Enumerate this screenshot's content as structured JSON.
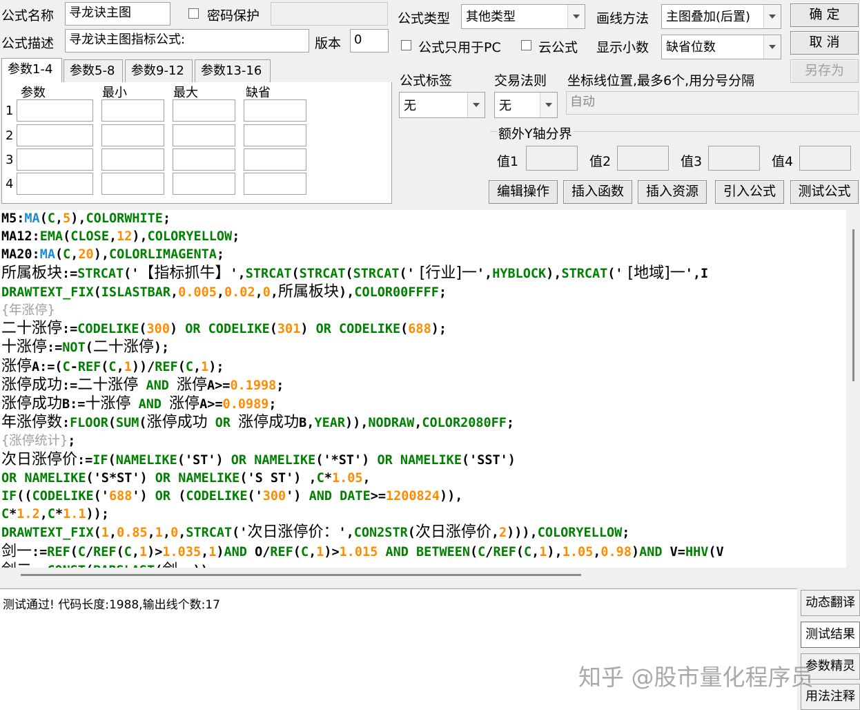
{
  "header": {
    "name_label": "公式名称",
    "name_value": "寻龙诀主图",
    "password_label": "密码保护",
    "password_value": "",
    "desc_label": "公式描述",
    "desc_value": "寻龙诀主图指标公式:",
    "version_label": "版本",
    "version_value": "0",
    "type_label": "公式类型",
    "type_value": "其他类型",
    "draw_label": "画线方法",
    "draw_value": "主图叠加(后置)",
    "pc_only_label": "公式只用于PC",
    "cloud_label": "云公式",
    "decimals_label": "显示小数",
    "decimals_value": "缺省位数"
  },
  "buttons": {
    "ok": "确  定",
    "cancel": "取  消",
    "save_as": "另存为",
    "edit_ops": "编辑操作",
    "insert_func": "插入函数",
    "insert_res": "插入资源",
    "import_formula": "引入公式",
    "test_formula": "测试公式"
  },
  "tabs": [
    "参数1-4",
    "参数5-8",
    "参数9-12",
    "参数13-16"
  ],
  "params": {
    "headers": [
      "参数",
      "最小",
      "最大",
      "缺省"
    ],
    "rows": [
      "1",
      "2",
      "3",
      "4"
    ]
  },
  "options": {
    "tag_label": "公式标签",
    "tag_value": "无",
    "trade_label": "交易法则",
    "trade_value": "无",
    "axis_label": "坐标线位置,最多6个,用分号分隔",
    "axis_value": "自动",
    "y_group_label": "额外Y轴分界",
    "y_vals": [
      "值1",
      "值2",
      "值3",
      "值4"
    ]
  },
  "code_lines": [
    [
      [
        "t",
        "M5:"
      ],
      [
        "f",
        "MA"
      ],
      [
        "t",
        "("
      ],
      [
        "k",
        "C"
      ],
      [
        "t",
        ","
      ],
      [
        "n",
        "5"
      ],
      [
        "t",
        "),"
      ],
      [
        "k",
        "COLORWHITE"
      ],
      [
        "t",
        ";"
      ]
    ],
    [
      [
        "t",
        "MA12:"
      ],
      [
        "k",
        "EMA"
      ],
      [
        "t",
        "("
      ],
      [
        "k",
        "CLOSE"
      ],
      [
        "t",
        ","
      ],
      [
        "n",
        "12"
      ],
      [
        "t",
        "),"
      ],
      [
        "k",
        "COLORYELLOW"
      ],
      [
        "t",
        ";"
      ]
    ],
    [
      [
        "t",
        "MA20:"
      ],
      [
        "f",
        "MA"
      ],
      [
        "t",
        "("
      ],
      [
        "k",
        "C"
      ],
      [
        "t",
        ","
      ],
      [
        "n",
        "20"
      ],
      [
        "t",
        "),"
      ],
      [
        "k",
        "COLORLIMAGENTA"
      ],
      [
        "t",
        ";"
      ]
    ],
    [
      [
        "cn",
        "所属板块"
      ],
      [
        "t",
        ":="
      ],
      [
        "k",
        "STRCAT"
      ],
      [
        "t",
        "('"
      ],
      [
        "cn",
        "【指标抓牛】"
      ],
      [
        "t",
        "',"
      ],
      [
        "k",
        "STRCAT"
      ],
      [
        "t",
        "("
      ],
      [
        "k",
        "STRCAT"
      ],
      [
        "t",
        "("
      ],
      [
        "k",
        "STRCAT"
      ],
      [
        "t",
        "('"
      ],
      [
        "cn",
        " [行业]一"
      ],
      [
        "t",
        "',"
      ],
      [
        "k",
        "HYBLOCK"
      ],
      [
        "t",
        "),"
      ],
      [
        "k",
        "STRCAT"
      ],
      [
        "t",
        "('"
      ],
      [
        "cn",
        " [地域]一"
      ],
      [
        "t",
        "',I"
      ]
    ],
    [
      [
        "k",
        "DRAWTEXT_FIX"
      ],
      [
        "t",
        "("
      ],
      [
        "k",
        "ISLASTBAR"
      ],
      [
        "t",
        ","
      ],
      [
        "n",
        "0.005"
      ],
      [
        "t",
        ","
      ],
      [
        "n",
        "0.02"
      ],
      [
        "t",
        ","
      ],
      [
        "n",
        "0"
      ],
      [
        "t",
        ","
      ],
      [
        "cn",
        "所属板块"
      ],
      [
        "t",
        "),"
      ],
      [
        "k",
        "COLOR00FFFF"
      ],
      [
        "t",
        ";"
      ]
    ],
    [
      [
        "cm",
        "{年涨停}"
      ]
    ],
    [
      [
        "cn",
        "二十涨停"
      ],
      [
        "t",
        ":="
      ],
      [
        "k",
        "CODELIKE"
      ],
      [
        "t",
        "("
      ],
      [
        "n",
        "300"
      ],
      [
        "t",
        ") "
      ],
      [
        "k",
        "OR"
      ],
      [
        "t",
        " "
      ],
      [
        "k",
        "CODELIKE"
      ],
      [
        "t",
        "("
      ],
      [
        "n",
        "301"
      ],
      [
        "t",
        ") "
      ],
      [
        "k",
        "OR"
      ],
      [
        "t",
        " "
      ],
      [
        "k",
        "CODELIKE"
      ],
      [
        "t",
        "("
      ],
      [
        "n",
        "688"
      ],
      [
        "t",
        ");"
      ]
    ],
    [
      [
        "cn",
        "十涨停"
      ],
      [
        "t",
        ":="
      ],
      [
        "k",
        "NOT"
      ],
      [
        "t",
        "("
      ],
      [
        "cn",
        "二十涨停"
      ],
      [
        "t",
        ");"
      ]
    ],
    [
      [
        "cn",
        "涨停"
      ],
      [
        "t",
        "A:=("
      ],
      [
        "k",
        "C"
      ],
      [
        "t",
        "-"
      ],
      [
        "k",
        "REF"
      ],
      [
        "t",
        "("
      ],
      [
        "k",
        "C"
      ],
      [
        "t",
        ","
      ],
      [
        "n",
        "1"
      ],
      [
        "t",
        "))/"
      ],
      [
        "k",
        "REF"
      ],
      [
        "t",
        "("
      ],
      [
        "k",
        "C"
      ],
      [
        "t",
        ","
      ],
      [
        "n",
        "1"
      ],
      [
        "t",
        ");"
      ]
    ],
    [
      [
        "cn",
        "涨停成功"
      ],
      [
        "t",
        ":="
      ],
      [
        "cn",
        "二十涨停"
      ],
      [
        "t",
        " "
      ],
      [
        "k",
        "AND"
      ],
      [
        "t",
        " "
      ],
      [
        "cn",
        "涨停"
      ],
      [
        "t",
        "A>="
      ],
      [
        "n",
        "0.1998"
      ],
      [
        "t",
        ";"
      ]
    ],
    [
      [
        "cn",
        "涨停成功"
      ],
      [
        "t",
        "B:="
      ],
      [
        "cn",
        "十涨停"
      ],
      [
        "t",
        " "
      ],
      [
        "k",
        "AND"
      ],
      [
        "t",
        " "
      ],
      [
        "cn",
        "涨停"
      ],
      [
        "t",
        "A>="
      ],
      [
        "n",
        "0.0989"
      ],
      [
        "t",
        ";"
      ]
    ],
    [
      [
        "cn",
        "年涨停数"
      ],
      [
        "t",
        ":"
      ],
      [
        "k",
        "FLOOR"
      ],
      [
        "t",
        "("
      ],
      [
        "k",
        "SUM"
      ],
      [
        "t",
        "("
      ],
      [
        "cn",
        "涨停成功"
      ],
      [
        "t",
        " "
      ],
      [
        "k",
        "OR"
      ],
      [
        "t",
        " "
      ],
      [
        "cn",
        "涨停成功"
      ],
      [
        "t",
        "B,"
      ],
      [
        "k",
        "YEAR"
      ],
      [
        "t",
        "))"
      ],
      [
        "t",
        ","
      ],
      [
        "k",
        "NODRAW"
      ],
      [
        "t",
        ","
      ],
      [
        "k",
        "COLOR2080FF"
      ],
      [
        "t",
        ";"
      ]
    ],
    [
      [
        "cm",
        "{涨停统计}"
      ],
      [
        "t",
        ";"
      ]
    ],
    [
      [
        "cn",
        "次日涨停价"
      ],
      [
        "t",
        ":="
      ],
      [
        "k",
        "IF"
      ],
      [
        "t",
        "("
      ],
      [
        "k",
        "NAMELIKE"
      ],
      [
        "t",
        "('ST') "
      ],
      [
        "k",
        "OR"
      ],
      [
        "t",
        " "
      ],
      [
        "k",
        "NAMELIKE"
      ],
      [
        "t",
        "('*ST') "
      ],
      [
        "k",
        "OR"
      ],
      [
        "t",
        " "
      ],
      [
        "k",
        "NAMELIKE"
      ],
      [
        "t",
        "('SST')"
      ]
    ],
    [
      [
        "k",
        "OR"
      ],
      [
        "t",
        " "
      ],
      [
        "k",
        "NAMELIKE"
      ],
      [
        "t",
        "('S*ST') "
      ],
      [
        "k",
        "OR"
      ],
      [
        "t",
        " "
      ],
      [
        "k",
        "NAMELIKE"
      ],
      [
        "t",
        "('S ST') ,"
      ],
      [
        "k",
        "C"
      ],
      [
        "t",
        "*"
      ],
      [
        "n",
        "1.05"
      ],
      [
        "t",
        ","
      ]
    ],
    [
      [
        "k",
        "IF"
      ],
      [
        "t",
        "(("
      ],
      [
        "k",
        "CODELIKE"
      ],
      [
        "t",
        "('"
      ],
      [
        "n",
        "688"
      ],
      [
        "t",
        "') "
      ],
      [
        "k",
        "OR"
      ],
      [
        "t",
        " ("
      ],
      [
        "k",
        "CODELIKE"
      ],
      [
        "t",
        "('"
      ],
      [
        "n",
        "300"
      ],
      [
        "t",
        "') "
      ],
      [
        "k",
        "AND"
      ],
      [
        "t",
        " "
      ],
      [
        "k",
        "DATE"
      ],
      [
        "t",
        ">="
      ],
      [
        "n",
        "1200824"
      ],
      [
        "t",
        ")),"
      ]
    ],
    [
      [
        "k",
        "C"
      ],
      [
        "t",
        "*"
      ],
      [
        "n",
        "1.2"
      ],
      [
        "t",
        ","
      ],
      [
        "k",
        "C"
      ],
      [
        "t",
        "*"
      ],
      [
        "n",
        "1.1"
      ],
      [
        "t",
        "));"
      ]
    ],
    [
      [
        "k",
        "DRAWTEXT_FIX"
      ],
      [
        "t",
        "("
      ],
      [
        "n",
        "1"
      ],
      [
        "t",
        ","
      ],
      [
        "n",
        "0.85"
      ],
      [
        "t",
        ","
      ],
      [
        "n",
        "1"
      ],
      [
        "t",
        ","
      ],
      [
        "n",
        "0"
      ],
      [
        "t",
        ","
      ],
      [
        "k",
        "STRCAT"
      ],
      [
        "t",
        "('"
      ],
      [
        "cn",
        "次日涨停价："
      ],
      [
        "t",
        "',"
      ],
      [
        "k",
        "CON2STR"
      ],
      [
        "t",
        "("
      ],
      [
        "cn",
        "次日涨停价"
      ],
      [
        "t",
        ","
      ],
      [
        "n",
        "2"
      ],
      [
        "t",
        ")))"
      ],
      [
        "t",
        ","
      ],
      [
        "k",
        "COLORYELLOW"
      ],
      [
        "t",
        ";"
      ]
    ],
    [
      [
        "cn",
        "剑一"
      ],
      [
        "t",
        ":="
      ],
      [
        "k",
        "REF"
      ],
      [
        "t",
        "("
      ],
      [
        "k",
        "C"
      ],
      [
        "t",
        "/"
      ],
      [
        "k",
        "REF"
      ],
      [
        "t",
        "("
      ],
      [
        "k",
        "C"
      ],
      [
        "t",
        ","
      ],
      [
        "n",
        "1"
      ],
      [
        "t",
        ")>"
      ],
      [
        "n",
        "1.035"
      ],
      [
        "t",
        ","
      ],
      [
        "n",
        "1"
      ],
      [
        "t",
        ")"
      ],
      [
        "k",
        "AND"
      ],
      [
        "t",
        " O/"
      ],
      [
        "k",
        "REF"
      ],
      [
        "t",
        "("
      ],
      [
        "k",
        "C"
      ],
      [
        "t",
        ","
      ],
      [
        "n",
        "1"
      ],
      [
        "t",
        ")>"
      ],
      [
        "n",
        "1.015"
      ],
      [
        "t",
        " "
      ],
      [
        "k",
        "AND"
      ],
      [
        "t",
        " "
      ],
      [
        "k",
        "BETWEEN"
      ],
      [
        "t",
        "("
      ],
      [
        "k",
        "C"
      ],
      [
        "t",
        "/"
      ],
      [
        "k",
        "REF"
      ],
      [
        "t",
        "("
      ],
      [
        "k",
        "C"
      ],
      [
        "t",
        ","
      ],
      [
        "n",
        "1"
      ],
      [
        "t",
        "),"
      ],
      [
        "n",
        "1.05"
      ],
      [
        "t",
        ","
      ],
      [
        "n",
        "0.98"
      ],
      [
        "t",
        ")"
      ],
      [
        "k",
        "AND"
      ],
      [
        "t",
        " V="
      ],
      [
        "k",
        "HHV"
      ],
      [
        "t",
        "(V"
      ]
    ],
    [
      [
        "cn",
        "剑二"
      ],
      [
        "t",
        ":="
      ],
      [
        "k",
        "CONST"
      ],
      [
        "t",
        "("
      ],
      [
        "k",
        "BARSLAST"
      ],
      [
        "t",
        "("
      ],
      [
        "cn",
        "剑一"
      ],
      [
        "t",
        "));"
      ]
    ]
  ],
  "output": {
    "message": "测试通过! 代码长度:1988,输出线个数:17"
  },
  "side_buttons": [
    "动态翻译",
    "测试结果",
    "参数精灵",
    "用法注释"
  ],
  "watermark": "知乎 @股市量化程序员"
}
